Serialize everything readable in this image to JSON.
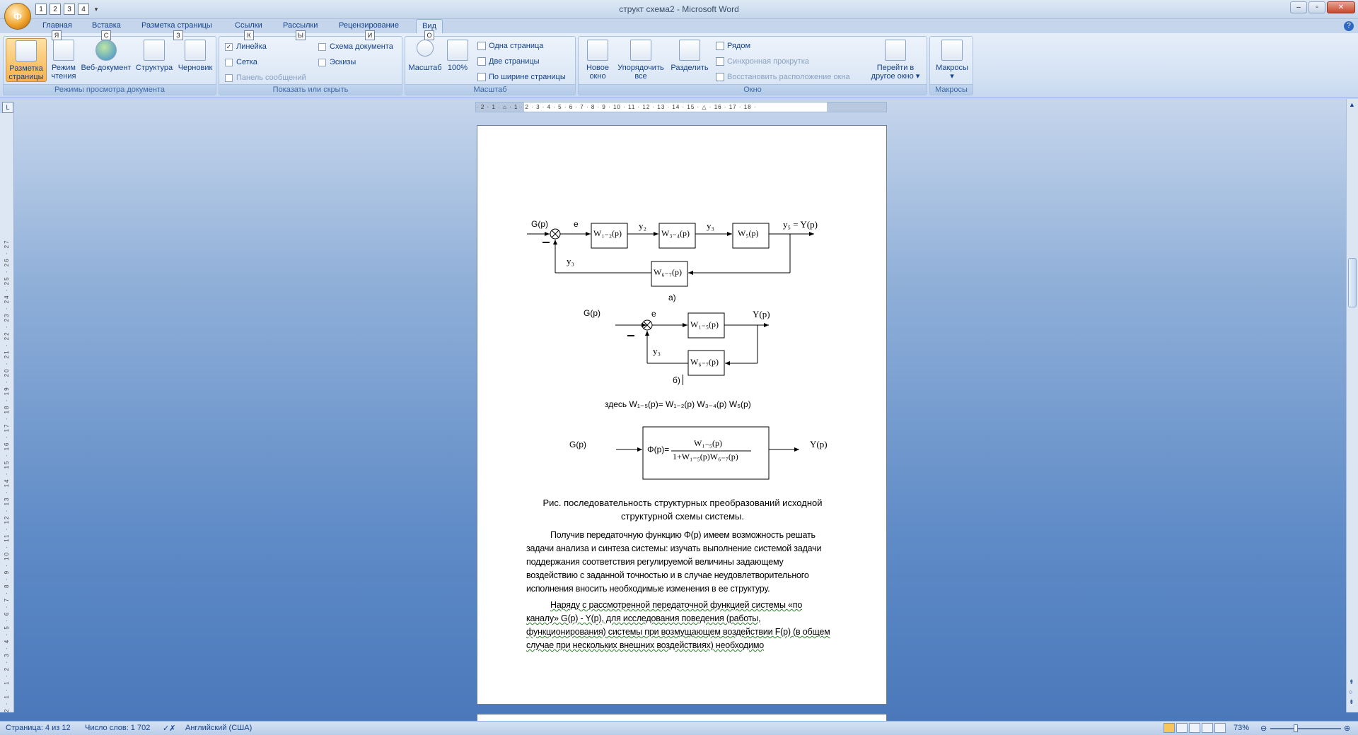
{
  "window": {
    "title": "структ схема2 - Microsoft Word",
    "office_button": "Ф",
    "qat_keys": [
      "1",
      "2",
      "3",
      "4"
    ]
  },
  "tabs": [
    {
      "label": "Главная",
      "key": "Я"
    },
    {
      "label": "Вставка",
      "key": "С"
    },
    {
      "label": "Разметка страницы",
      "key": "З"
    },
    {
      "label": "Ссылки",
      "key": "К"
    },
    {
      "label": "Рассылки",
      "key": "Ы"
    },
    {
      "label": "Рецензирование",
      "key": "И"
    },
    {
      "label": "Вид",
      "key": "О"
    }
  ],
  "ribbon": {
    "view_modes": {
      "label": "Режимы просмотра документа",
      "buttons": [
        "Разметка страницы",
        "Режим чтения",
        "Веб-документ",
        "Структура",
        "Черновик"
      ]
    },
    "show_hide": {
      "label": "Показать или скрыть",
      "ruler": "Линейка",
      "grid": "Сетка",
      "message_bar": "Панель сообщений",
      "doc_map": "Схема документа",
      "thumbnails": "Эскизы"
    },
    "zoom": {
      "label": "Масштаб",
      "zoom_btn": "Масштаб",
      "zoom_100": "100%",
      "one_page": "Одна страница",
      "two_pages": "Две страницы",
      "page_width": "По ширине страницы"
    },
    "window_group": {
      "label": "Окно",
      "new_window": "Новое окно",
      "arrange_all": "Упорядочить все",
      "split": "Разделить",
      "side_by_side": "Рядом",
      "sync_scroll": "Синхронная прокрутка",
      "reset_position": "Восстановить расположение окна",
      "switch_windows": "Перейти в другое окно"
    },
    "macros": {
      "label": "Макросы",
      "button": "Макросы"
    }
  },
  "ruler": {
    "h_text": "· 2 · 1 · ⌂ · 1 · 2 · 3 · 4 · 5 · 6 · 7 · 8 · 9 · 10 · 11 · 12 · 13 · 14 · 15 · △ · 16 · 17 · 18 ·",
    "v_text": "2 · 1 · 1 · 2 · 3 · 4 · 5 · 6 · 7 · 8 · 9 · 10 · 11 · 12 · 13 · 14 · 15 · 16 · 17 · 18 · 19 · 20 · 21 · 22 · 23 · 24 · 25 · 26 · 27"
  },
  "document": {
    "diagram_a": {
      "input": "G(p)",
      "error": "e",
      "minus": "–",
      "block1": "W₁₋₂(p)",
      "y2": "y₂",
      "block2": "W₃₋₄(p)",
      "y3": "y₃",
      "block3": "W₅(p)",
      "output": "y₅ = Y(p)",
      "feedback_block": "W₆₋₇(p)",
      "feedback_signal": "y₃",
      "caption": "а)"
    },
    "diagram_b": {
      "input": "G(p)",
      "error": "e",
      "minus": "–",
      "block": "W₁₋₅(p)",
      "output": "Y(p)",
      "feedback_block": "W₆₋₇(p)",
      "feedback_signal": "y₃",
      "caption": "б)"
    },
    "note": "здесь W₁₋₅(p)= W₁₋₂(p) W₃₋₄(p) W₅(p)",
    "diagram_c": {
      "input": "G(p)",
      "phi": "Φ(p)=",
      "numerator": "W₁₋₅(p)",
      "denominator": "1+W₁₋₅(p)W₆₋₇(p)",
      "output": "Y(p)"
    },
    "figure_caption": "Рис.   последовательность структурных преобразований исходной структурной схемы системы.",
    "paragraph1": "Получив передаточную функцию Φ(p) имеем возможность решать задачи анализа и синтеза системы: изучать выполнение системой задачи поддержания соответствия регулируемой величины задающему воздействию с заданной точностью и в случае неудовлетворительного исполнения вносить необходимые изменения в ее структуру.",
    "paragraph2": "Наряду с рассмотренной передаточной функцией системы «по каналу» G(p) - Y(p), для исследования поведения  (работы, функционирования) системы при возмущающем воздействии F(p) (в общем случае при нескольких внешних воздействиях) необходимо"
  },
  "statusbar": {
    "page": "Страница: 4 из 12",
    "words": "Число слов: 1 702",
    "language": "Английский (США)",
    "zoom": "73%"
  }
}
